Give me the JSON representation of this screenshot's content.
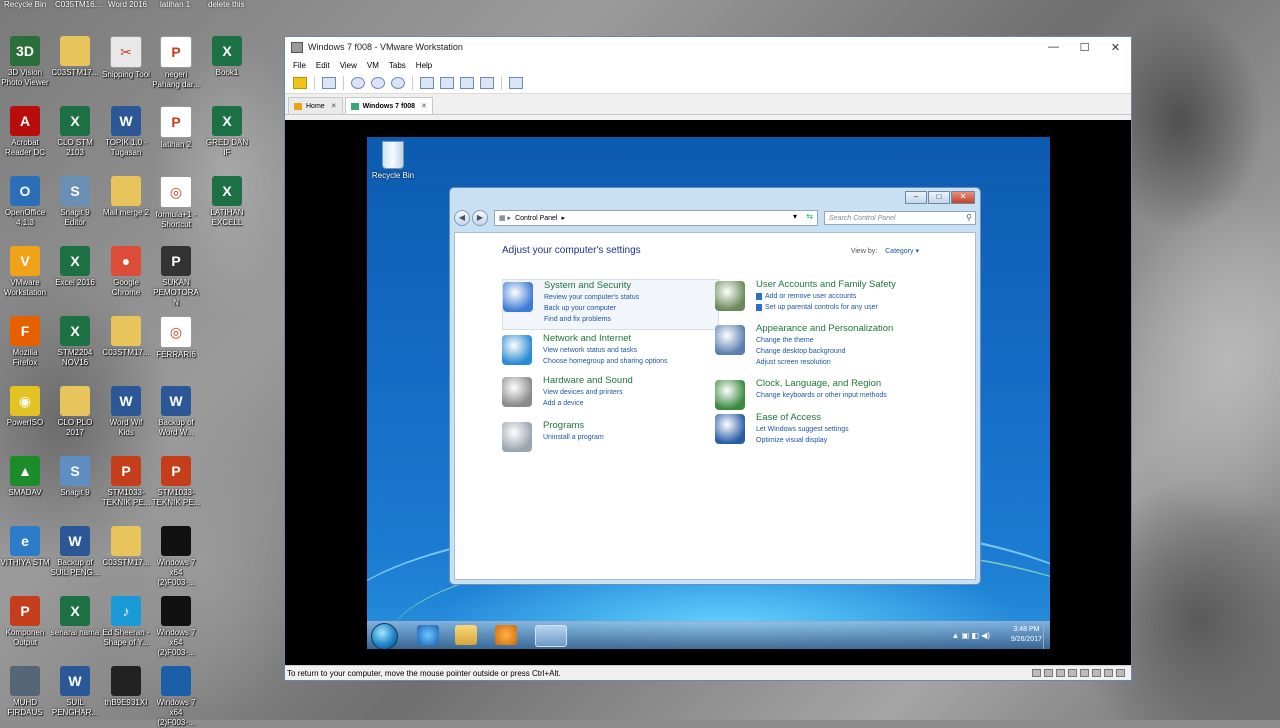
{
  "desktop": {
    "top_labels": [
      "Recycle Bin",
      "C035TM16...",
      "Word 2016",
      "latihan 1",
      "delete this"
    ],
    "icons": [
      {
        "label": "3D Vision Photo Viewer",
        "icon": "3d-vision-icon",
        "color": "#2c6e3a",
        "glyph": "3D"
      },
      {
        "label": "C03STM17...",
        "icon": "folder-icon",
        "color": "#e7c45c",
        "glyph": ""
      },
      {
        "label": "Snipping Tool",
        "icon": "scissors-icon",
        "color": "#e8e8e8",
        "glyph": "✂"
      },
      {
        "label": "negeri Pahang dar...",
        "icon": "powerpoint-doc-icon",
        "color": "#ffffff",
        "glyph": "P"
      },
      {
        "label": "Book1",
        "icon": "excel-doc-icon",
        "color": "#1d7044",
        "glyph": "X"
      },
      {
        "label": "Acrobat Reader DC",
        "icon": "acrobat-icon",
        "color": "#b80d0d",
        "glyph": "A"
      },
      {
        "label": "CLO STM 2103",
        "icon": "excel-doc-icon",
        "color": "#1d7044",
        "glyph": "X"
      },
      {
        "label": "TOPIK 1.0 - Tugasan",
        "icon": "word-doc-icon",
        "color": "#2b5797",
        "glyph": "W"
      },
      {
        "label": "latihan 2",
        "icon": "powerpoint-doc-icon",
        "color": "#ffffff",
        "glyph": "P"
      },
      {
        "label": "GRED DAN IF",
        "icon": "excel-doc-icon",
        "color": "#1d7044",
        "glyph": "X"
      },
      {
        "label": "OpenOffice 4.1.3",
        "icon": "openoffice-icon",
        "color": "#2a6fb7",
        "glyph": "O"
      },
      {
        "label": "Snagit 9 Editor",
        "icon": "snagit-icon",
        "color": "#6a8fb5",
        "glyph": "S"
      },
      {
        "label": "Mail merge 2",
        "icon": "folder-icon",
        "color": "#e7c45c",
        "glyph": ""
      },
      {
        "label": "formula+1 - Shortcut",
        "icon": "shortcut-icon",
        "color": "#ffffff",
        "glyph": "◎"
      },
      {
        "label": "LATIHAN EXCELL",
        "icon": "excel-doc-icon",
        "color": "#1d7044",
        "glyph": "X"
      },
      {
        "label": "VMware Workstation",
        "icon": "vmware-icon",
        "color": "#f0a21a",
        "glyph": "V"
      },
      {
        "label": "Excel 2016",
        "icon": "excel-icon",
        "color": "#1d7044",
        "glyph": "X"
      },
      {
        "label": "Google Chrome",
        "icon": "chrome-icon",
        "color": "#dd4b39",
        "glyph": "●"
      },
      {
        "label": "SUKAN PEMOTORAN",
        "icon": "powerpoint-doc-icon",
        "color": "#333333",
        "glyph": "P"
      },
      {
        "label": "",
        "icon": "",
        "color": "",
        "glyph": ""
      },
      {
        "label": "Mozilla Firefox",
        "icon": "firefox-icon",
        "color": "#e66000",
        "glyph": "F"
      },
      {
        "label": "STM2204 NOV16",
        "icon": "excel-doc-icon",
        "color": "#1d7044",
        "glyph": "X"
      },
      {
        "label": "C03STM17...",
        "icon": "folder-icon",
        "color": "#e7c45c",
        "glyph": ""
      },
      {
        "label": "FERRARI6",
        "icon": "shortcut-icon",
        "color": "#ffffff",
        "glyph": "◎"
      },
      {
        "label": "",
        "icon": "",
        "color": "",
        "glyph": ""
      },
      {
        "label": "PowerISO",
        "icon": "poweriso-icon",
        "color": "#e3c223",
        "glyph": "◉"
      },
      {
        "label": "CLO PLO 2017",
        "icon": "folder-icon",
        "color": "#e7c45c",
        "glyph": ""
      },
      {
        "label": "Word Wif Kids",
        "icon": "word-doc-icon",
        "color": "#2b5797",
        "glyph": "W"
      },
      {
        "label": "Backup of Word W...",
        "icon": "word-doc-icon",
        "color": "#2b5797",
        "glyph": "W"
      },
      {
        "label": "",
        "icon": "",
        "color": "",
        "glyph": ""
      },
      {
        "label": "SMADAV",
        "icon": "smadav-icon",
        "color": "#1c8c2a",
        "glyph": "▲"
      },
      {
        "label": "Snagit 9",
        "icon": "snagit-icon",
        "color": "#5f8fc2",
        "glyph": "S"
      },
      {
        "label": "STM1033- TEKNIK PE...",
        "icon": "powerpoint-doc-icon",
        "color": "#c43e1c",
        "glyph": "P"
      },
      {
        "label": "STM1033- TEKNIK PE...",
        "icon": "powerpoint-doc-icon",
        "color": "#c43e1c",
        "glyph": "P"
      },
      {
        "label": "",
        "icon": "",
        "color": "",
        "glyph": ""
      },
      {
        "label": "VITHIYA STM",
        "icon": "pdf-icon",
        "color": "#2d7cc9",
        "glyph": "e"
      },
      {
        "label": "Backup of SUIL PENG...",
        "icon": "word-doc-icon",
        "color": "#2b5797",
        "glyph": "W"
      },
      {
        "label": "C03STM17...",
        "icon": "folder-icon",
        "color": "#e7c45c",
        "glyph": ""
      },
      {
        "label": "Windows 7 x64 (2)F003-...",
        "icon": "vm-screenshot-icon",
        "color": "#111111",
        "glyph": ""
      },
      {
        "label": "",
        "icon": "",
        "color": "",
        "glyph": ""
      },
      {
        "label": "Komponen Output",
        "icon": "powerpoint-doc-icon",
        "color": "#c43e1c",
        "glyph": "P"
      },
      {
        "label": "senarai nama",
        "icon": "excel-doc-icon",
        "color": "#1d7044",
        "glyph": "X"
      },
      {
        "label": "Ed Sheeran - Shape of Y...",
        "icon": "media-icon",
        "color": "#1a9ad6",
        "glyph": "♪"
      },
      {
        "label": "Windows 7 x64 (2)F003-...",
        "icon": "vm-screenshot-icon",
        "color": "#111111",
        "glyph": ""
      },
      {
        "label": "",
        "icon": "",
        "color": "",
        "glyph": ""
      },
      {
        "label": "MUHD FIRDAUS",
        "icon": "image-icon",
        "color": "#556677",
        "glyph": ""
      },
      {
        "label": "SUIL PENGHAR...",
        "icon": "word-doc-icon",
        "color": "#2b5797",
        "glyph": "W"
      },
      {
        "label": "thB9E931XI",
        "icon": "image-icon",
        "color": "#222222",
        "glyph": ""
      },
      {
        "label": "Windows 7 x64 (2)F003-...",
        "icon": "vm-screenshot-icon",
        "color": "#1b5fa8",
        "glyph": ""
      }
    ]
  },
  "vmware": {
    "title": "Windows 7 f008 - VMware Workstation",
    "controls": {
      "minimize": "—",
      "maximize": "☐",
      "close": "✕"
    },
    "menu": [
      "File",
      "Edit",
      "View",
      "VM",
      "Tabs",
      "Help"
    ],
    "tabs": [
      {
        "label": "Home",
        "active": false
      },
      {
        "label": "Windows 7 f008",
        "active": true
      }
    ],
    "status_text": "To return to your computer, move the mouse pointer outside or press Ctrl+Alt."
  },
  "guest": {
    "recycle_bin_label": "Recycle Bin",
    "control_panel": {
      "address": "Control Panel",
      "search_placeholder": "Search Control Panel",
      "heading": "Adjust your computer's settings",
      "view_by_label": "View by:",
      "view_by_value": "Category",
      "categories_left": [
        {
          "title": "System and Security",
          "icon": "shield-icon",
          "color": "#3d7bd6",
          "links": [
            "Review your computer's status",
            "Back up your computer",
            "Find and fix problems"
          ]
        },
        {
          "title": "Network and Internet",
          "icon": "network-globe-icon",
          "color": "#2a8bd4",
          "links": [
            "View network status and tasks",
            "Choose homegroup and sharing options"
          ]
        },
        {
          "title": "Hardware and Sound",
          "icon": "printer-icon",
          "color": "#8a8a8a",
          "links": [
            "View devices and printers",
            "Add a device"
          ]
        },
        {
          "title": "Programs",
          "icon": "programs-icon",
          "color": "#9aa4ad",
          "links": [
            "Uninstall a program"
          ]
        }
      ],
      "categories_right": [
        {
          "title": "User Accounts and Family Safety",
          "icon": "users-icon",
          "color": "#6a8a5a",
          "links": [
            "Add or remove user accounts",
            "Set up parental controls for any user"
          ]
        },
        {
          "title": "Appearance and Personalization",
          "icon": "monitor-icon",
          "color": "#5b7fb0",
          "links": [
            "Change the theme",
            "Change desktop background",
            "Adjust screen resolution"
          ]
        },
        {
          "title": "Clock, Language, and Region",
          "icon": "globe-clock-icon",
          "color": "#3a8a3f",
          "links": [
            "Change keyboards or other input methods"
          ]
        },
        {
          "title": "Ease of Access",
          "icon": "ease-of-access-icon",
          "color": "#2a5da8",
          "links": [
            "Let Windows suggest settings",
            "Optimize visual display"
          ]
        }
      ]
    },
    "taskbar": {
      "time": "3:48 PM",
      "date": "9/26/2017"
    }
  }
}
